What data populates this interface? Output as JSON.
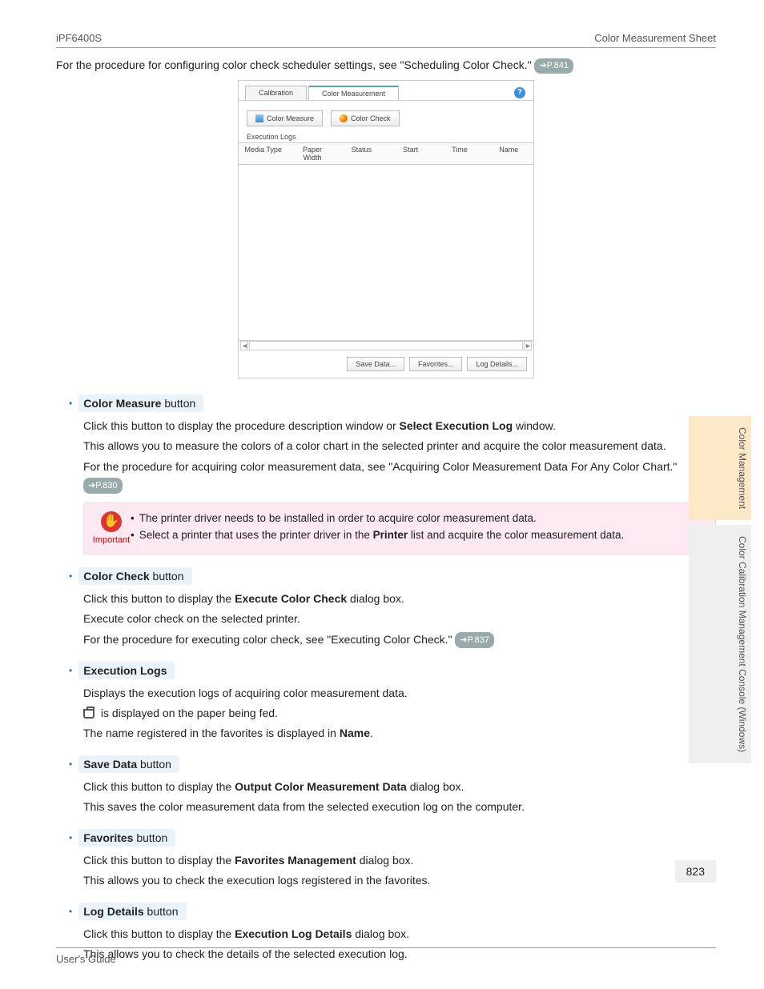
{
  "header": {
    "left": "iPF6400S",
    "right": "Color Measurement Sheet"
  },
  "intro": {
    "text_before": "For the procedure for configuring color check scheduler settings, see \"Scheduling Color Check.\" ",
    "pill": "➔P.841"
  },
  "screenshot": {
    "tab1": "Calibration",
    "tab2": "Color Measurement",
    "btn1": "Color Measure",
    "btn2": "Color Check",
    "section": "Execution Logs",
    "cols": [
      "Media Type",
      "Paper Width",
      "Status",
      "Start",
      "Time",
      "Name"
    ],
    "bot_btns": [
      "Save Data...",
      "Favorites...",
      "Log Details..."
    ]
  },
  "sections": [
    {
      "head_strong": "Color Measure",
      "head_rest": " button",
      "paras": [
        {
          "plain_before": "Click this button to display the procedure description window or ",
          "bold": "Select Execution Log",
          "plain_after": " window."
        },
        {
          "plain": "This allows you to measure the colors of a color chart in the selected printer and acquire the color measurement data."
        },
        {
          "plain_before": "For the procedure for acquiring color measurement data, see \"Acquiring Color Measurement Data For Any Color Chart.\" ",
          "pill": "➔P.830"
        }
      ],
      "note": {
        "label": "Important",
        "items": [
          {
            "text": "The printer driver needs to be installed in order to acquire color measurement data."
          },
          {
            "text_before": "Select a printer that uses the printer driver in the ",
            "bold": "Printer",
            "text_after": " list and acquire the color measurement data."
          }
        ]
      }
    },
    {
      "head_strong": "Color Check",
      "head_rest": " button",
      "paras": [
        {
          "plain_before": "Click this button to display the ",
          "bold": "Execute Color Check",
          "plain_after": " dialog box."
        },
        {
          "plain": "Execute color check on the selected printer."
        },
        {
          "plain_before": "For the procedure for executing color check, see \"Executing Color Check.\" ",
          "pill": "➔P.837"
        }
      ]
    },
    {
      "head_strong": "Execution Logs",
      "head_rest": "",
      "paras": [
        {
          "plain": "Displays the execution logs of acquiring color measurement data."
        },
        {
          "icon": true,
          "plain": " is displayed on the paper being fed."
        },
        {
          "plain_before": "The name registered in the favorites is displayed in ",
          "bold": "Name",
          "plain_after": "."
        }
      ]
    },
    {
      "head_strong": "Save Data",
      "head_rest": " button",
      "paras": [
        {
          "plain_before": "Click this button to display the ",
          "bold": "Output Color Measurement Data",
          "plain_after": " dialog box."
        },
        {
          "plain": "This saves the color measurement data from the selected execution log on the computer."
        }
      ]
    },
    {
      "head_strong": "Favorites",
      "head_rest": " button",
      "paras": [
        {
          "plain_before": "Click this button to display the ",
          "bold": "Favorites Management",
          "plain_after": " dialog box."
        },
        {
          "plain": "This allows you to check the execution logs registered in the favorites."
        }
      ]
    },
    {
      "head_strong": "Log Details",
      "head_rest": " button",
      "paras": [
        {
          "plain_before": "Click this button to display the ",
          "bold": "Execution Log Details",
          "plain_after": " dialog box."
        },
        {
          "plain": "This allows you to check the details of the selected execution log."
        }
      ]
    }
  ],
  "side": {
    "tab1": "Color Management",
    "tab2": "Color Calibration Management Console (Windows)"
  },
  "page_number": "823",
  "footer": "User's Guide"
}
